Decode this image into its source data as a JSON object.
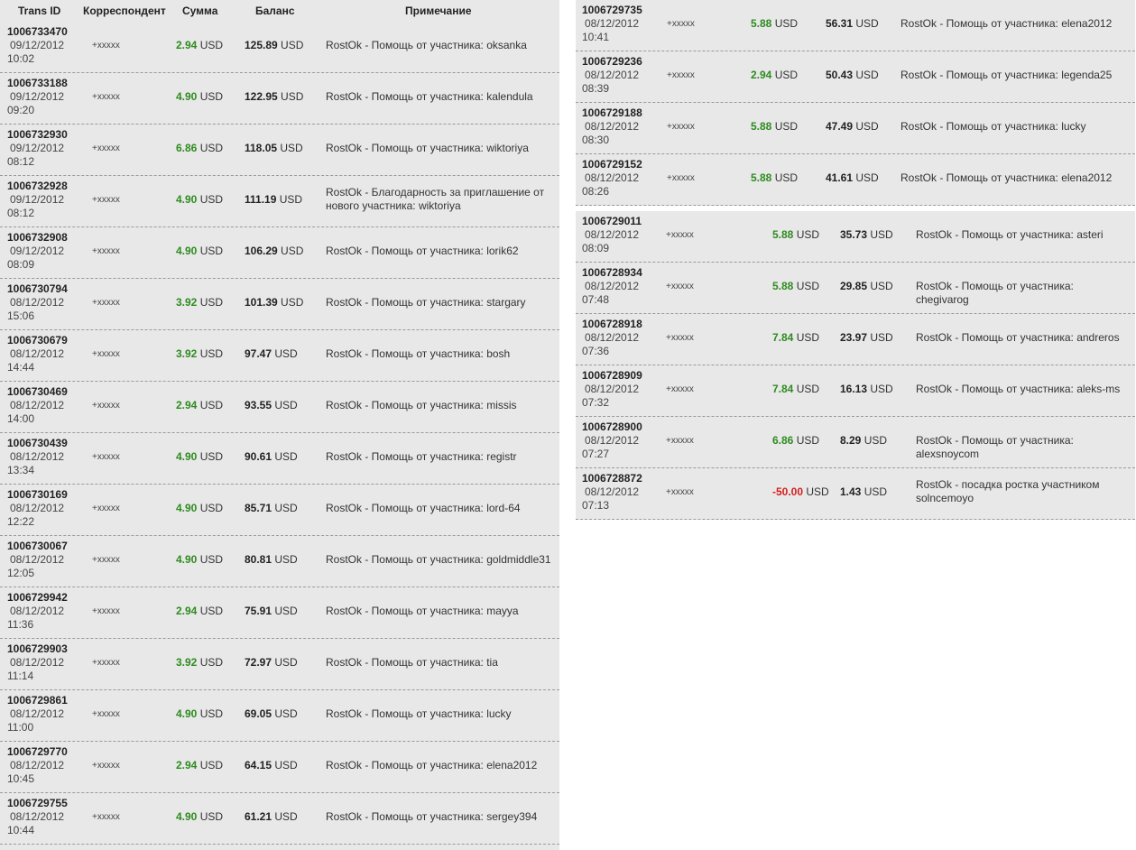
{
  "header": {
    "trans_id": "Trans ID",
    "correspondent": "Корреспондент",
    "amount": "Сумма",
    "balance": "Баланс",
    "note": "Примечание"
  },
  "currency": "USD",
  "colors": {
    "positive": "#2e8b1f",
    "negative": "#d41e1e",
    "row_bg": "#e8e8e8"
  },
  "left_rows": [
    {
      "id": "1006733470",
      "date": "09/12/2012",
      "time": "10:02",
      "corr": "+xxxxx",
      "amount": "2.94",
      "balance": "125.89",
      "note": "RostOk - Помощь от участника: oksanka"
    },
    {
      "id": "1006733188",
      "date": "09/12/2012",
      "time": "09:20",
      "corr": "+xxxxx",
      "amount": "4.90",
      "balance": "122.95",
      "note": "RostOk - Помощь от участника: kalendula"
    },
    {
      "id": "1006732930",
      "date": "09/12/2012",
      "time": "08:12",
      "corr": "+xxxxx",
      "amount": "6.86",
      "balance": "118.05",
      "note": "RostOk - Помощь от участника: wiktoriya"
    },
    {
      "id": "1006732928",
      "date": "09/12/2012",
      "time": "08:12",
      "corr": "+xxxxx",
      "amount": "4.90",
      "balance": "111.19",
      "note": "RostOk - Благодарность за приглашение от нового участника: wiktoriya"
    },
    {
      "id": "1006732908",
      "date": "09/12/2012",
      "time": "08:09",
      "corr": "+xxxxx",
      "amount": "4.90",
      "balance": "106.29",
      "note": "RostOk - Помощь от участника: lorik62"
    },
    {
      "id": "1006730794",
      "date": "08/12/2012",
      "time": "15:06",
      "corr": "+xxxxx",
      "amount": "3.92",
      "balance": "101.39",
      "note": "RostOk - Помощь от участника: stargary"
    },
    {
      "id": "1006730679",
      "date": "08/12/2012",
      "time": "14:44",
      "corr": "+xxxxx",
      "amount": "3.92",
      "balance": "97.47",
      "note": "RostOk - Помощь от участника: bosh"
    },
    {
      "id": "1006730469",
      "date": "08/12/2012",
      "time": "14:00",
      "corr": "+xxxxx",
      "amount": "2.94",
      "balance": "93.55",
      "note": "RostOk - Помощь от участника: missis"
    },
    {
      "id": "1006730439",
      "date": "08/12/2012",
      "time": "13:34",
      "corr": "+xxxxx",
      "amount": "4.90",
      "balance": "90.61",
      "note": "RostOk - Помощь от участника: registr"
    },
    {
      "id": "1006730169",
      "date": "08/12/2012",
      "time": "12:22",
      "corr": "+xxxxx",
      "amount": "4.90",
      "balance": "85.71",
      "note": "RostOk - Помощь от участника: lord-64"
    },
    {
      "id": "1006730067",
      "date": "08/12/2012",
      "time": "12:05",
      "corr": "+xxxxx",
      "amount": "4.90",
      "balance": "80.81",
      "note": "RostOk - Помощь от участника: goldmiddle31"
    },
    {
      "id": "1006729942",
      "date": "08/12/2012",
      "time": "11:36",
      "corr": "+xxxxx",
      "amount": "2.94",
      "balance": "75.91",
      "note": "RostOk - Помощь от участника: mayya"
    },
    {
      "id": "1006729903",
      "date": "08/12/2012",
      "time": "11:14",
      "corr": "+xxxxx",
      "amount": "3.92",
      "balance": "72.97",
      "note": "RostOk - Помощь от участника: tia"
    },
    {
      "id": "1006729861",
      "date": "08/12/2012",
      "time": "11:00",
      "corr": "+xxxxx",
      "amount": "4.90",
      "balance": "69.05",
      "note": "RostOk - Помощь от участника: lucky"
    },
    {
      "id": "1006729770",
      "date": "08/12/2012",
      "time": "10:45",
      "corr": "+xxxxx",
      "amount": "2.94",
      "balance": "64.15",
      "note": "RostOk - Помощь от участника: elena2012"
    },
    {
      "id": "1006729755",
      "date": "08/12/2012",
      "time": "10:44",
      "corr": "+xxxxx",
      "amount": "4.90",
      "balance": "61.21",
      "note": "RostOk - Помощь от участника: sergey394"
    }
  ],
  "right_rows_a": [
    {
      "id": "1006729735",
      "date": "08/12/2012",
      "time": "10:41",
      "corr": "+xxxxx",
      "amount": "5.88",
      "balance": "56.31",
      "note": "RostOk - Помощь от участника: elena2012"
    },
    {
      "id": "1006729236",
      "date": "08/12/2012",
      "time": "08:39",
      "corr": "+xxxxx",
      "amount": "2.94",
      "balance": "50.43",
      "note": "RostOk - Помощь от участника: legenda25"
    },
    {
      "id": "1006729188",
      "date": "08/12/2012",
      "time": "08:30",
      "corr": "+xxxxx",
      "amount": "5.88",
      "balance": "47.49",
      "note": "RostOk - Помощь от участника: lucky"
    },
    {
      "id": "1006729152",
      "date": "08/12/2012",
      "time": "08:26",
      "corr": "+xxxxx",
      "amount": "5.88",
      "balance": "41.61",
      "note": "RostOk - Помощь от участника: elena2012"
    }
  ],
  "right_rows_b": [
    {
      "id": "1006729011",
      "date": "08/12/2012",
      "time": "08:09",
      "corr": "+xxxxx",
      "amount": "5.88",
      "balance": "35.73",
      "note": "RostOk - Помощь от участника: asteri"
    },
    {
      "id": "1006728934",
      "date": "08/12/2012",
      "time": "07:48",
      "corr": "+xxxxx",
      "amount": "5.88",
      "balance": "29.85",
      "note": "RostOk - Помощь от участника: chegivarog"
    },
    {
      "id": "1006728918",
      "date": "08/12/2012",
      "time": "07:36",
      "corr": "+xxxxx",
      "amount": "7.84",
      "balance": "23.97",
      "note": "RostOk - Помощь от участника: andreros"
    },
    {
      "id": "1006728909",
      "date": "08/12/2012",
      "time": "07:32",
      "corr": "+xxxxx",
      "amount": "7.84",
      "balance": "16.13",
      "note": "RostOk - Помощь от участника: aleks-ms"
    },
    {
      "id": "1006728900",
      "date": "08/12/2012",
      "time": "07:27",
      "corr": "+xxxxx",
      "amount": "6.86",
      "balance": "8.29",
      "note": "RostOk - Помощь от участника: alexsnoycom"
    },
    {
      "id": "1006728872",
      "date": "08/12/2012",
      "time": "07:13",
      "corr": "+xxxxx",
      "amount": "-50.00",
      "balance": "1.43",
      "note": "RostOk - посадка ростка участником solncemoyo"
    }
  ]
}
